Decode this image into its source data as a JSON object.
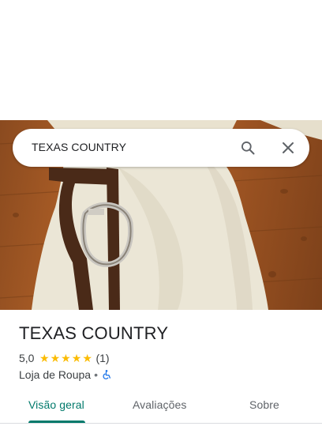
{
  "search": {
    "query": "TEXAS COUNTRY",
    "search_icon": "search-icon",
    "close_icon": "close-icon"
  },
  "place": {
    "name": "TEXAS COUNTRY",
    "rating": "5,0",
    "stars": 5,
    "review_count": "(1)",
    "category": "Loja de Roupa",
    "separator": "•",
    "accessibility_icon": "wheelchair-icon"
  },
  "tabs": [
    {
      "label": "Visão geral",
      "active": true
    },
    {
      "label": "Avaliações",
      "active": false
    },
    {
      "label": "Sobre",
      "active": false
    }
  ],
  "colors": {
    "accent": "#00796b",
    "star": "#fbbc04",
    "accessibility": "#1a73e8"
  }
}
